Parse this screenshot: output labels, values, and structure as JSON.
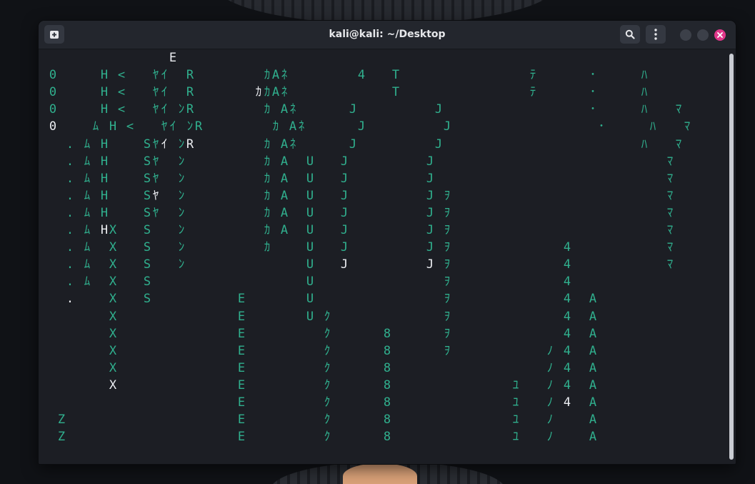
{
  "window": {
    "title": "kali@kali: ~/Desktop",
    "icons": {
      "new_tab": "new-tab-icon",
      "search": "search-icon",
      "menu": "kebab-menu-icon",
      "minimize": "minimize-icon",
      "maximize": "maximize-icon",
      "close": "close-icon"
    },
    "colors": {
      "glyph": "#30b08e",
      "glyph_head": "#eceef2",
      "close": "#e0378a",
      "background": "#1c1e24"
    }
  },
  "terminal": {
    "rows": [
      "              E",
      "0     H <   ﾔｲ  R        ｶAﾈ        4   T               ﾃ      ･     ﾊ",
      "0     H <   ﾔｲ  R       ｶｶAﾈ            T               ﾃ      ･     ﾊ",
      "0     H <   ﾔｲ ﾝR        ｶ Aﾈ      J         J                 ･     ﾊ   ﾏ",
      "0    ﾑ H <   ﾔｲ ﾝR        ｶ Aﾈ      J         J                 ･     ﾊ   ﾏ",
      "  . ﾑ H    Sﾔｲ ﾝR        ｶ Aﾈ      J         J                       ﾊ   ﾏ",
      "  . ﾑ H    Sﾔ  ﾝ         ｶ A  U   J         J                           ﾏ",
      "  . ﾑ H    Sﾔ  ﾝ         ｶ A  U   J         J                           ﾏ",
      "  . ﾑ H    Sﾔ  ﾝ         ｶ A  U   J         J ｦ                         ﾏ",
      "  . ﾑ H    Sﾔ  ﾝ         ｶ A  U   J         J ｦ                         ﾏ",
      "  . ﾑ HX   S   ﾝ         ｶ A  U   J         J ｦ                         ﾏ",
      "  . ﾑ  X   S   ﾝ         ｶ    U   J         J ｦ             4           ﾏ",
      "  . ﾑ  X   S   ﾝ              U   J         J ｦ             4           ﾏ",
      "  . ﾑ  X   S                  U               ｦ             4",
      "  .    X   S          E       U               ｦ             4  A",
      "       X              E       U ｸ             ｦ             4  A",
      "       X              E         ｸ      8      ｦ             4  A",
      "       X              E         ｸ      8      ｦ           ﾉ 4  A",
      "       X              E         ｸ      8                  ﾉ 4  A",
      "       X              E         ｸ      8              ﾕ   ﾉ 4  A",
      "                      E         ｸ      8              ﾕ   ﾉ 4  A",
      " Z                    E         ｸ      8              ﾕ   ﾉ    A",
      " Z                    E         ｸ      8              ﾕ   ﾉ    A"
    ],
    "highlight": [
      "0,14",
      "1,31",
      "2,24",
      "4,0",
      "4,8",
      "5,13",
      "5,16",
      "5,24",
      "5,70",
      "8,12",
      "10,6",
      "10,24",
      "11,22",
      "12,14",
      "12,34",
      "12,44",
      "12,73",
      "13,5",
      "14,2",
      "14,10",
      "15,31",
      "17,47",
      "19,7",
      "20,60"
    ]
  }
}
